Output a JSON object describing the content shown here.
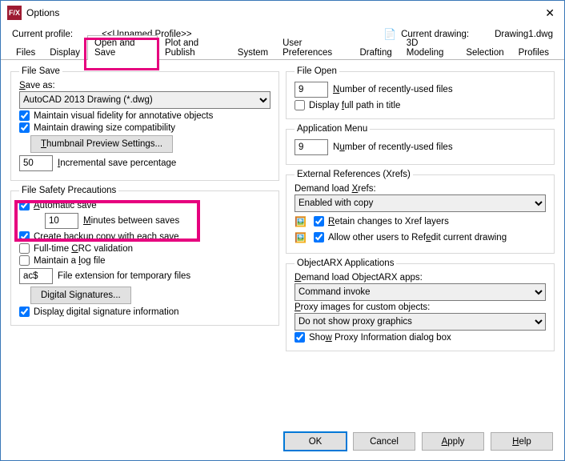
{
  "window": {
    "title": "Options"
  },
  "header": {
    "profile_label": "Current profile:",
    "profile_value": "<<Unnamed Profile>>",
    "drawing_label": "Current drawing:",
    "drawing_value": "Drawing1.dwg"
  },
  "tabs": [
    "Files",
    "Display",
    "Open and Save",
    "Plot and Publish",
    "System",
    "User Preferences",
    "Drafting",
    "3D Modeling",
    "Selection",
    "Profiles"
  ],
  "active_tab_index": 2,
  "left": {
    "file_save": {
      "legend": "File Save",
      "save_as_label": "Save as:",
      "save_as_value": "AutoCAD 2013 Drawing (*.dwg)",
      "maintain_visual": "Maintain visual fidelity for annotative objects",
      "maintain_size": "Maintain drawing size compatibility",
      "thumbnail_btn": "Thumbnail Preview Settings...",
      "incremental_value": "50",
      "incremental_label": "Incremental save percentage"
    },
    "safety": {
      "legend": "File Safety Precautions",
      "auto_save": "Automatic save",
      "minutes_value": "10",
      "minutes_label": "Minutes between saves",
      "backup": "Create backup copy with each save",
      "crc": "Full-time CRC validation",
      "logfile": "Maintain a log file",
      "ext_value": "ac$",
      "ext_label": "File extension for temporary files",
      "digital_btn": "Digital Signatures...",
      "display_sig": "Display digital signature information"
    }
  },
  "right": {
    "file_open": {
      "legend": "File Open",
      "recent_value": "9",
      "recent_label": "Number of recently-used files",
      "full_path": "Display full path in title"
    },
    "app_menu": {
      "legend": "Application Menu",
      "recent_value": "9",
      "recent_label": "Number of recently-used files"
    },
    "xrefs": {
      "legend": "External References (Xrefs)",
      "demand_label": "Demand load Xrefs:",
      "demand_value": "Enabled with copy",
      "retain": "Retain changes to Xref layers",
      "allow": "Allow other users to Refedit current drawing"
    },
    "arx": {
      "legend": "ObjectARX Applications",
      "demand_label": "Demand load ObjectARX apps:",
      "demand_value": "Command invoke",
      "proxy_label": "Proxy images for custom objects:",
      "proxy_value": "Do not show proxy graphics",
      "show_proxy": "Show Proxy Information dialog box"
    }
  },
  "footer": {
    "ok": "OK",
    "cancel": "Cancel",
    "apply": "Apply",
    "help": "Help"
  }
}
